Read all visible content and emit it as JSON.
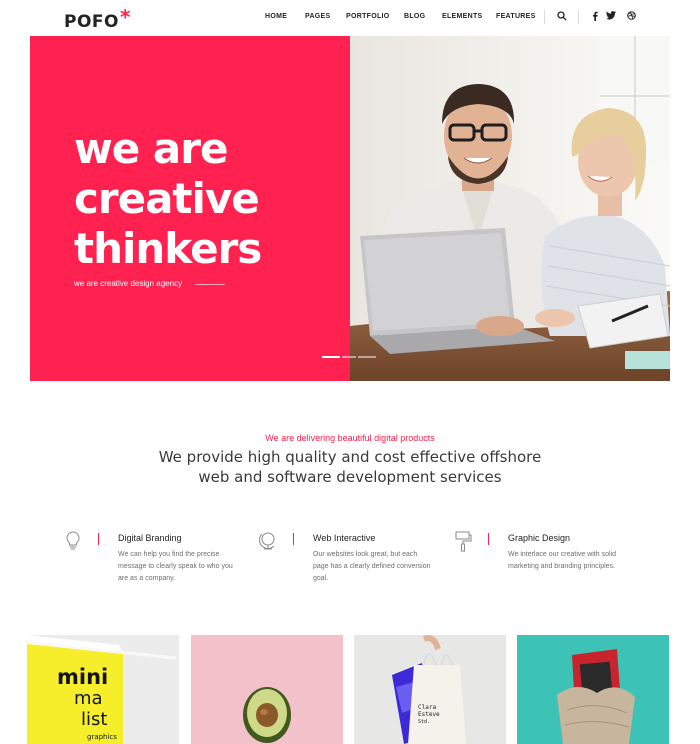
{
  "brand": {
    "name": "POFO",
    "mark": "*"
  },
  "nav": {
    "items": [
      "HOME",
      "PAGES",
      "PORTFOLIO",
      "BLOG",
      "ELEMENTS",
      "FEATURES"
    ],
    "icons": [
      "search-icon",
      "facebook-icon",
      "twitter-icon",
      "dribbble-icon"
    ]
  },
  "hero": {
    "title_lines": [
      "we are",
      "creative",
      "thinkers"
    ],
    "subtitle": "we are creative design agency",
    "slides": 3,
    "active_slide": 1,
    "accent": "#ff214f"
  },
  "intro": {
    "kicker": "We are delivering beautiful digital products",
    "headline_line1": "We provide high quality and cost effective offshore",
    "headline_line2": "web and software development services"
  },
  "features": [
    {
      "icon": "lightbulb-icon",
      "title": "Digital Branding",
      "desc": "We can help you find the precise message to clearly speak to who you are as a company."
    },
    {
      "icon": "globe-icon",
      "title": "Web Interactive",
      "desc": "Our websites look great, but each page has a clearly defined conversion goal."
    },
    {
      "icon": "paint-roller-icon",
      "title": "Graphic Design",
      "desc": "We interlace our creative with solid marketing and branding principles."
    }
  ],
  "portfolio": {
    "book_text": [
      "mini",
      "ma",
      "list",
      "graphics"
    ],
    "bag_text": [
      "Clara",
      "Esteve",
      "Std."
    ]
  }
}
